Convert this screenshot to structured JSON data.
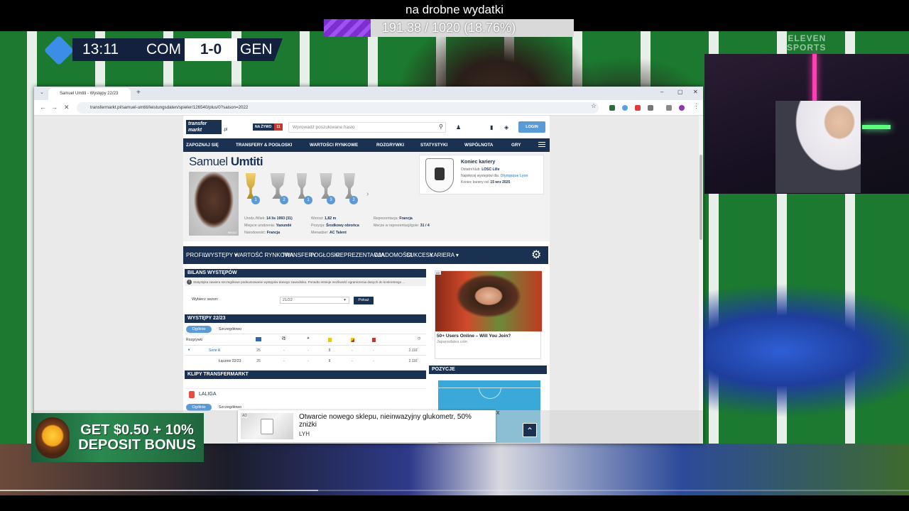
{
  "stream": {
    "goal_title": "na drobne wydatki",
    "goal_text": "191.38 / 1020 (18.76%)",
    "goal_fraction": 0.1876,
    "video_progress_fraction": 0.35,
    "accent_purple": "#8b3fe0"
  },
  "scorebug": {
    "time": "13:11",
    "team1": "COM",
    "score": "1-0",
    "team2": "GEN"
  },
  "broadcaster": {
    "name_line1": "ELEVEN",
    "name_line2": "SPORTS"
  },
  "browser": {
    "tab_title": "Samuel Umtiti - Występy 22/23",
    "url": "transfermarkt.pl/samuel-umtiti/leistungsdaten/spieler/126540/plus/0?saison=2022",
    "icons": {
      "back": "←",
      "forward": "→",
      "reload": "✕",
      "newtab": "+",
      "tabclose": "×",
      "min": "–",
      "max": "▢",
      "close": "✕",
      "star": "☆"
    }
  },
  "site": {
    "logo_line1": "transfer",
    "logo_line2": "markt",
    "logo_suffix": ".pl",
    "live_label": "NA ŻYWO",
    "live_count": "11",
    "search_placeholder": "Wprowadź poszukiwane hasło",
    "login_label": "LOGIN",
    "nav": [
      "ZAPOZNAJ SIĘ",
      "TRANSFERY & POGŁOSKI",
      "WARTOŚCI RYNKOWE",
      "ROZGRYWKI",
      "STATYSTYKI",
      "WSPÓLNOTA",
      "GRY"
    ]
  },
  "player": {
    "first_name": "Samuel",
    "last_name": "Umtiti",
    "photo_caption": "IMAGO",
    "trophy_counts": [
      "1",
      "2",
      "1",
      "3",
      "2"
    ],
    "career": {
      "title": "Koniec kariery",
      "last_club_label": "Ostatni klub:",
      "last_club": "LOSC Lille",
      "most_apps_label": "Najwięcej występów dla:",
      "most_apps": "Olympique Lyon",
      "end_label": "Koniec kariery od:",
      "end_date": "15 wrz 2025"
    },
    "info": {
      "birth_label": "Urodz./Wiek:",
      "birth_value": "14 lis 1993 (31)",
      "place_label": "Miejsce urodzenia:",
      "place_value": "Yaoundé",
      "nationality_label": "Narodowość:",
      "nationality_value": "Francja",
      "height_label": "Wzrost:",
      "height_value": "1,82 m",
      "position_label": "Pozycja:",
      "position_value": "Środkowy obrońca",
      "agent_label": "Menadżer:",
      "agent_value": "AC Talent",
      "national_label": "Reprezentacja:",
      "national_value": "Francja",
      "caps_label": "Mecze w reprezentacji/gole:",
      "caps_value": "31 / 4"
    }
  },
  "subnav": [
    "PROFIL",
    "WYSTĘPY ▾",
    "WARTOŚĆ RYNKOWA",
    "TRANSFERY",
    "POGŁOSKI",
    "REPREZENTACJA",
    "WIADOMOŚCI",
    "SUKCESY",
    "KARIERA ▾"
  ],
  "stats": {
    "summary_header": "BILANS WYSTĘPÓW",
    "note": "Statystyka zawiera szczegółowe podsumowanie występów danego zawodnika. Ponadto istnieje możliwość ograniczenia danych do konkretnego ...",
    "season_label": "Wybierz sezon:",
    "season_value": "21/22",
    "show_button": "Pokaż",
    "season_header": "WYSTĘPY 22/23",
    "tab_general": "Ogólnie",
    "tab_detailed": "Szczegółowo",
    "col_competitions": "Rozgrywki",
    "rows": [
      {
        "name": "Serie A",
        "apps": "25",
        "c1": "-",
        "c2": "-",
        "c3": "8",
        "c4": "-",
        "c5": "-",
        "mins": "2.116'"
      },
      {
        "name": "Łącznie 22/23:",
        "apps": "25",
        "c1": "-",
        "c2": "-",
        "c3": "8",
        "c4": "-",
        "c5": "-",
        "mins": "2.116'"
      }
    ],
    "clips_header": "KLIPY TRANSFERMARKT",
    "laliga_label": "LALIGA",
    "laliga_tab1": "Ogólnie",
    "laliga_tab2": "Szczegółowo"
  },
  "side_ad": {
    "badge": "AD",
    "title": "50+ Users Online – Will You Join?",
    "source": "Japansdates.com"
  },
  "position_header": "POZYCJE",
  "overlay_ad": {
    "tag": "AD",
    "title": "Otwarcie nowego sklepu, nieinwazyjny glukometr, 50% zniżki",
    "brand": "LYH",
    "close": "x"
  },
  "up_arrow": "⌃",
  "bonus": {
    "line1": "GET $0.50 + 10%",
    "line2": "DEPOSIT BONUS"
  }
}
